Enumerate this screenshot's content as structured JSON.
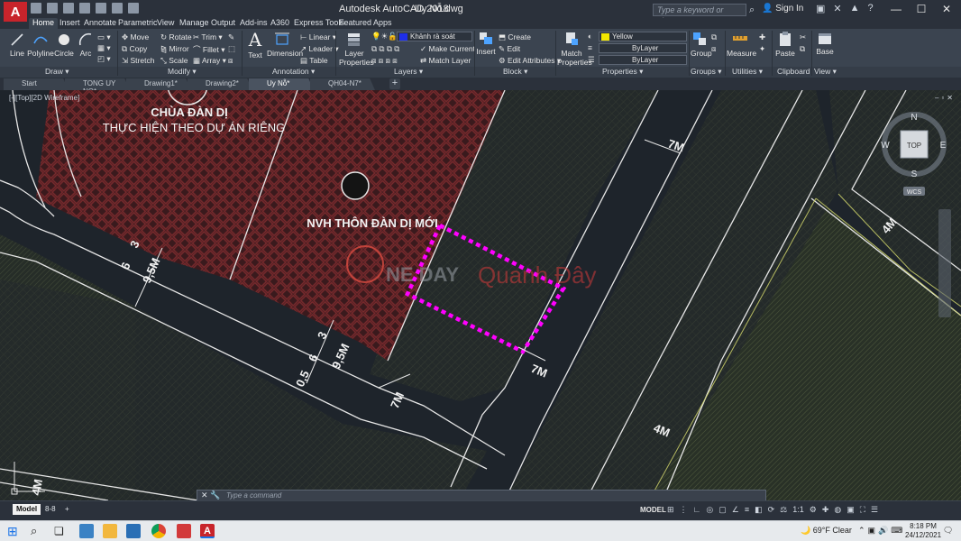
{
  "app": {
    "logo": "A",
    "title": "Autodesk AutoCAD 2018",
    "file": "Uy Nỗ.dwg",
    "search_placeholder": "Type a keyword or phrase",
    "sign_in": "Sign In"
  },
  "ribbon_tabs": [
    "Home",
    "Insert",
    "Annotate",
    "Parametric",
    "View",
    "Manage",
    "Output",
    "Add-ins",
    "A360",
    "Express Tools",
    "Featured Apps"
  ],
  "ribbon": {
    "draw": {
      "line": "Line",
      "polyline": "Polyline",
      "circle": "Circle",
      "arc": "Arc",
      "label": "Draw"
    },
    "modify": {
      "move": "Move",
      "rotate": "Rotate",
      "trim": "Trim",
      "copy": "Copy",
      "mirror": "Mirror",
      "fillet": "Fillet",
      "stretch": "Stretch",
      "scale": "Scale",
      "array": "Array",
      "label": "Modify"
    },
    "annotation": {
      "text": "Text",
      "dimension": "Dimension",
      "linear": "Linear",
      "leader": "Leader",
      "table": "Table",
      "label": "Annotation"
    },
    "layers": {
      "layer_properties": "Layer Properties",
      "current_layer": "Khảnh rà soát",
      "make_current": "Make Current",
      "match_layer": "Match Layer",
      "label": "Layers"
    },
    "block": {
      "insert": "Insert",
      "create": "Create",
      "edit": "Edit",
      "edit_attributes": "Edit Attributes",
      "label": "Block"
    },
    "properties": {
      "match_properties": "Match Properties",
      "color": "Yellow",
      "linetype": "ByLayer",
      "lineweight": "ByLayer",
      "label": "Properties"
    },
    "groups": {
      "group": "Group",
      "label": "Groups"
    },
    "utilities": {
      "measure": "Measure",
      "label": "Utilities"
    },
    "clipboard": {
      "paste": "Paste",
      "label": "Clipboard"
    },
    "view": {
      "base": "Base",
      "label": "View"
    },
    "colors": {
      "yellow": "#f2e600",
      "layer_blue": "#1e2ee8"
    }
  },
  "doc_tabs": [
    "Start",
    "TONG UY NO*",
    "Drawing1*",
    "Drawing2*",
    "Uy Nỗ*",
    "QH04-N7*"
  ],
  "viewport": {
    "label": "[-][Top][2D Wireframe]",
    "viewcube": {
      "top": "TOP",
      "n": "N",
      "s": "S",
      "e": "E",
      "w": "W",
      "wcs": "WCS"
    },
    "drawing_text": {
      "pagoda_line1": "CHÙA ĐÀN DỊ",
      "pagoda_line2": "THỰC HIỆN THEO DỰ ÁN RIÊNG",
      "culture_house": "NVH THÔN ĐÀN DỊ MỚI",
      "road_7m": "7M",
      "road_9_5m": "9,5M",
      "road_4m": "4M",
      "dim_3": "3",
      "dim_6": "6",
      "dim_0_5": "0,5"
    },
    "watermark": {
      "brand_a": "NE DAY",
      "brand_b": "Quanh Đây"
    },
    "colors": {
      "highlight": "#ff00ff",
      "hatch_red": "#6a2222",
      "road_edge": "#e6e6e6"
    }
  },
  "command_line": {
    "placeholder": "Type a command"
  },
  "status_bar": {
    "tab_model": "Model",
    "tab_layout": "8-8",
    "model": "MODEL",
    "scale": "1:1"
  },
  "taskbar": {
    "weather": "69°F  Clear",
    "time": "8:18 PM",
    "date": "24/12/2021"
  }
}
